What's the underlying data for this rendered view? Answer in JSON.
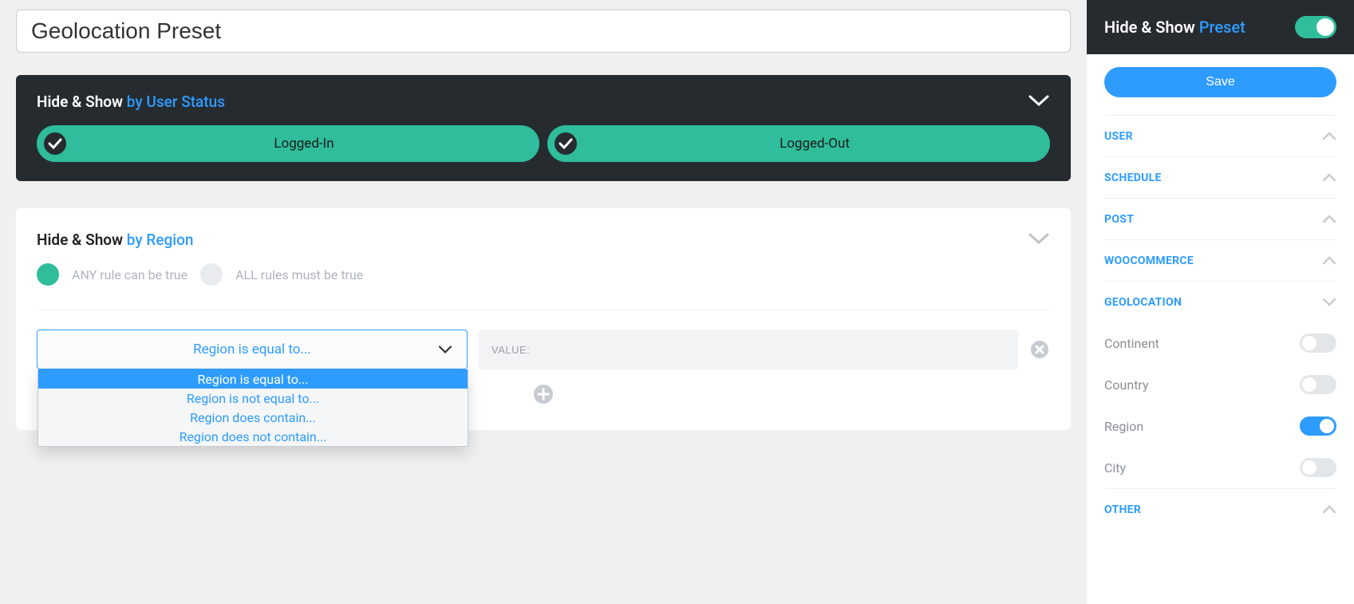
{
  "presetTitle": "Geolocation Preset",
  "userStatus": {
    "heading": "Hide & Show ",
    "accent": "by User Status",
    "options": [
      "Logged-In",
      "Logged-Out"
    ]
  },
  "region": {
    "heading": "Hide & Show ",
    "accent": "by Region",
    "mode": {
      "any": "ANY rule can be true",
      "all": "ALL rules must be true"
    },
    "select": {
      "current": "Region is equal to...",
      "options": [
        "Region is equal to...",
        "Region is not equal to...",
        "Region does contain...",
        "Region does not contain..."
      ]
    },
    "valuePlaceholder": "VALUE:"
  },
  "sidebar": {
    "header": {
      "text": "Hide & Show ",
      "accent": "Preset"
    },
    "save": "Save",
    "cats": [
      {
        "label": "USER",
        "open": false
      },
      {
        "label": "SCHEDULE",
        "open": false
      },
      {
        "label": "POST",
        "open": false
      },
      {
        "label": "WOOCOMMERCE",
        "open": false
      },
      {
        "label": "GEOLOCATION",
        "open": true,
        "items": [
          {
            "label": "Continent",
            "on": false
          },
          {
            "label": "Country",
            "on": false
          },
          {
            "label": "Region",
            "on": true
          },
          {
            "label": "City",
            "on": false
          }
        ]
      },
      {
        "label": "OTHER",
        "open": false
      }
    ]
  }
}
